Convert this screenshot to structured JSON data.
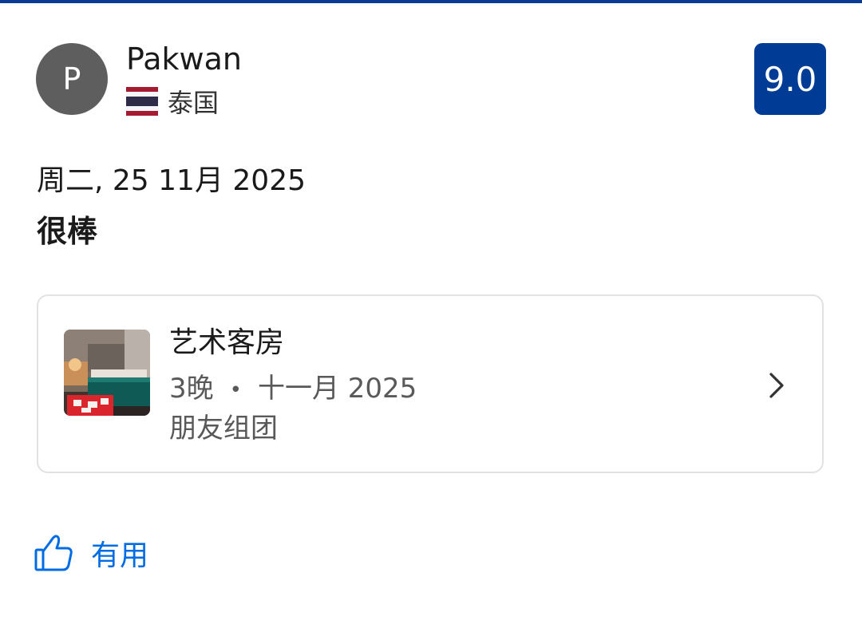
{
  "reviewer": {
    "avatar_initial": "P",
    "name": "Pakwan",
    "country": "泰国",
    "flag_icon": "thailand-flag-icon"
  },
  "score": "9.0",
  "review": {
    "date": "周二, 25 11月 2025",
    "title": "很棒"
  },
  "room_card": {
    "room_name": "艺术客房",
    "nights": "3晚",
    "separator": "•",
    "stay_month": "十一月 2025",
    "traveler_type": "朋友组团",
    "chevron_icon": "chevron-right-icon"
  },
  "helpful": {
    "label": "有用",
    "icon": "thumbs-up-icon"
  },
  "colors": {
    "brand_top_bar": "#0a3a92",
    "score_badge": "#003b95",
    "avatar_bg": "#5e5e5e",
    "link_blue": "#006ce4"
  }
}
